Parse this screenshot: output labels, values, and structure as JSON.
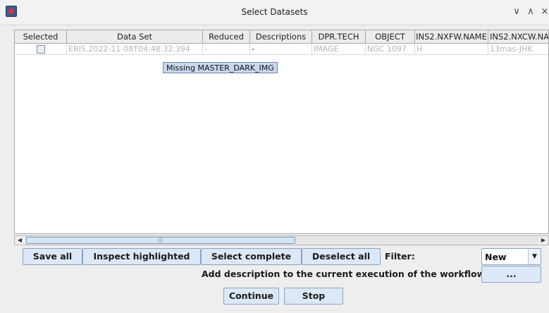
{
  "window": {
    "title": "Select Datasets",
    "controls": [
      "∨",
      "∧",
      "×"
    ]
  },
  "table": {
    "columns": [
      "Selected",
      "Data Set",
      "Reduced",
      "Descriptions",
      "DPR.TECH",
      "OBJECT",
      "INS2.NXFW.NAME",
      "INS2.NXCW.NA"
    ],
    "rows": [
      {
        "selected": false,
        "data_set": "ERIS.2022-11-08T04:48:32.394",
        "reduced": "-",
        "descriptions": "-",
        "dpr_tech": "IMAGE",
        "object": "NGC 1097",
        "nxfw_name": "H",
        "nxcw_name": "13mas-JHK"
      }
    ],
    "tooltip": "Missing MASTER_DARK_IMG"
  },
  "buttons": {
    "save_all": "Save all",
    "inspect_highlighted": "Inspect highlighted",
    "select_complete": "Select complete",
    "deselect_all": "Deselect all",
    "more": "...",
    "continue": "Continue",
    "stop": "Stop"
  },
  "filter": {
    "label": "Filter:",
    "value": "New"
  },
  "description_label": "Add description to the current execution of the workflow:",
  "scrollbar": {
    "grip": "|||"
  }
}
